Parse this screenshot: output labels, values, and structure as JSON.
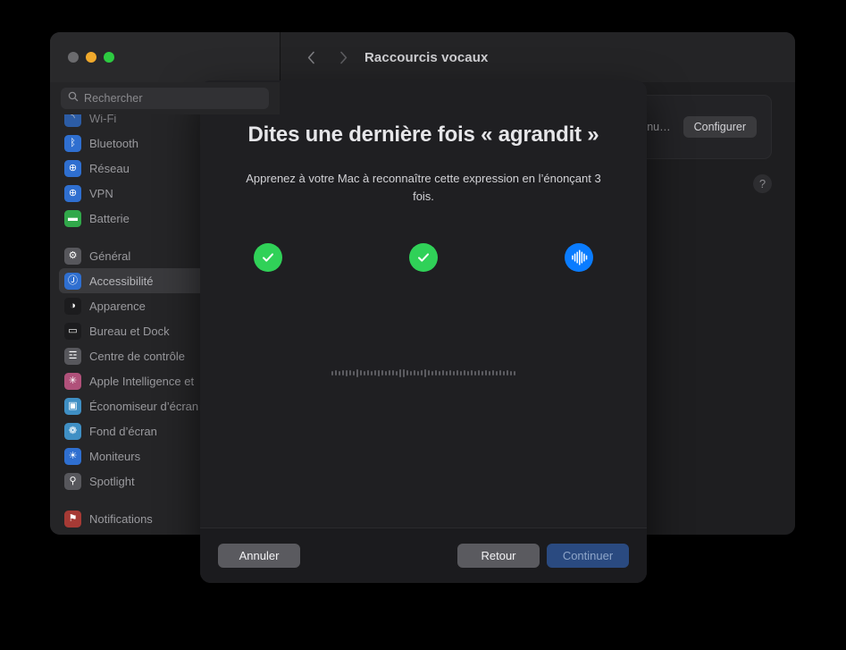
{
  "window": {
    "title": "Raccourcis vocaux",
    "back_icon": "chevron-left-icon",
    "forward_icon": "chevron-right-icon",
    "traffic_lights": [
      "close",
      "minimize",
      "maximize"
    ]
  },
  "search": {
    "placeholder": "Rechercher",
    "icon": "search-icon"
  },
  "sidebar": {
    "items": [
      {
        "label": "Wi-Fi",
        "icon": "wifi-icon",
        "color": "#2f6fd0",
        "selected": false,
        "clipped_top": true
      },
      {
        "label": "Bluetooth",
        "icon": "bluetooth-icon",
        "color": "#2f6fd0",
        "selected": false
      },
      {
        "label": "Réseau",
        "icon": "globe-icon",
        "color": "#2f6fd0",
        "selected": false
      },
      {
        "label": "VPN",
        "icon": "vpn-globe-icon",
        "color": "#2f6fd0",
        "selected": false
      },
      {
        "label": "Batterie",
        "icon": "battery-icon",
        "color": "#31a84a",
        "selected": false
      },
      {
        "label": "__GAP__",
        "icon": "",
        "color": "",
        "selected": false
      },
      {
        "label": "Général",
        "icon": "gear-icon",
        "color": "#57575c",
        "selected": false
      },
      {
        "label": "Accessibilité",
        "icon": "accessibility-icon",
        "color": "#2f6fd0",
        "selected": true
      },
      {
        "label": "Apparence",
        "icon": "appearance-icon",
        "color": "#1c1c1e",
        "selected": false
      },
      {
        "label": "Bureau et Dock",
        "icon": "desktop-dock-icon",
        "color": "#1c1c1e",
        "selected": false
      },
      {
        "label": "Centre de contrôle",
        "icon": "control-center-icon",
        "color": "#57575c",
        "selected": false
      },
      {
        "label": "Apple Intelligence et",
        "icon": "apple-intelligence-icon",
        "color": "#b0517a",
        "selected": false
      },
      {
        "label": "Économiseur d’écran",
        "icon": "screensaver-icon",
        "color": "#3f8fc4",
        "selected": false
      },
      {
        "label": "Fond d’écran",
        "icon": "wallpaper-icon",
        "color": "#3f8fc4",
        "selected": false
      },
      {
        "label": "Moniteurs",
        "icon": "display-icon",
        "color": "#2f6fd0",
        "selected": false
      },
      {
        "label": "Spotlight",
        "icon": "spotlight-icon",
        "color": "#57575c",
        "selected": false
      },
      {
        "label": "__GAP__",
        "icon": "",
        "color": "",
        "selected": false
      },
      {
        "label": "Notifications",
        "icon": "notifications-icon",
        "color": "#a63a35",
        "selected": false
      }
    ]
  },
  "detail": {
    "card_text": "…e que …contenu",
    "configure_label": "Configurer",
    "help_label": "?"
  },
  "dialog": {
    "title": "Dites une dernière fois « agrandit »",
    "subtitle": "Apprenez à votre Mac à reconnaître cette expression en l’énonçant 3 fois.",
    "steps": [
      {
        "state": "done",
        "icon": "checkmark-icon"
      },
      {
        "state": "done",
        "icon": "checkmark-icon"
      },
      {
        "state": "active",
        "icon": "waveform-icon"
      }
    ],
    "meter": {
      "icon": "audio-level-meter",
      "bar_count": 52,
      "heights": [
        5,
        6,
        5,
        6,
        7,
        6,
        5,
        9,
        6,
        5,
        6,
        5,
        6,
        7,
        6,
        5,
        6,
        6,
        5,
        9,
        9,
        6,
        5,
        6,
        5,
        6,
        9,
        6,
        5,
        6,
        5,
        6,
        5,
        6,
        5,
        6,
        5,
        6,
        5,
        6,
        5,
        6,
        5,
        6,
        5,
        6,
        5,
        6,
        5,
        6,
        5,
        5
      ]
    },
    "buttons": {
      "cancel": "Annuler",
      "back": "Retour",
      "continue": "Continuer"
    }
  },
  "colors": {
    "green": "#30d158",
    "blue": "#0a7cff",
    "primary_disabled": "#2a4a80"
  }
}
